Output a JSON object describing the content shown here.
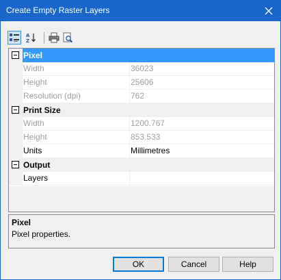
{
  "window": {
    "title": "Create Empty Raster Layers",
    "close_icon": "close-icon"
  },
  "toolbar": {
    "buttons": [
      {
        "icon": "categorized-view-icon",
        "active": true
      },
      {
        "icon": "sort-alphabetical-icon",
        "active": false
      },
      {
        "icon": "print-icon",
        "active": false
      },
      {
        "icon": "print-preview-icon",
        "active": false
      }
    ]
  },
  "grid": {
    "categories": [
      {
        "label": "Pixel",
        "selected": true,
        "properties": [
          {
            "name": "Width",
            "value": "36023",
            "disabled": true
          },
          {
            "name": "Height",
            "value": "25606",
            "disabled": true
          },
          {
            "name": "Resolution (dpi)",
            "value": "762",
            "disabled": true
          }
        ]
      },
      {
        "label": "Print Size",
        "selected": false,
        "properties": [
          {
            "name": "Width",
            "value": "1200.767",
            "disabled": true
          },
          {
            "name": "Height",
            "value": "853.533",
            "disabled": true
          },
          {
            "name": "Units",
            "value": "Millimetres",
            "disabled": false
          }
        ]
      },
      {
        "label": "Output",
        "selected": false,
        "properties": [
          {
            "name": "Layers",
            "value": "",
            "disabled": false
          }
        ]
      }
    ]
  },
  "description": {
    "title": "Pixel",
    "text": "Pixel properties."
  },
  "buttons": {
    "ok": "OK",
    "cancel": "Cancel",
    "help": "Help"
  },
  "colors": {
    "titlebar": "#1a66cc",
    "selection": "#3399ff",
    "disabled_text": "#a0a0a0"
  }
}
